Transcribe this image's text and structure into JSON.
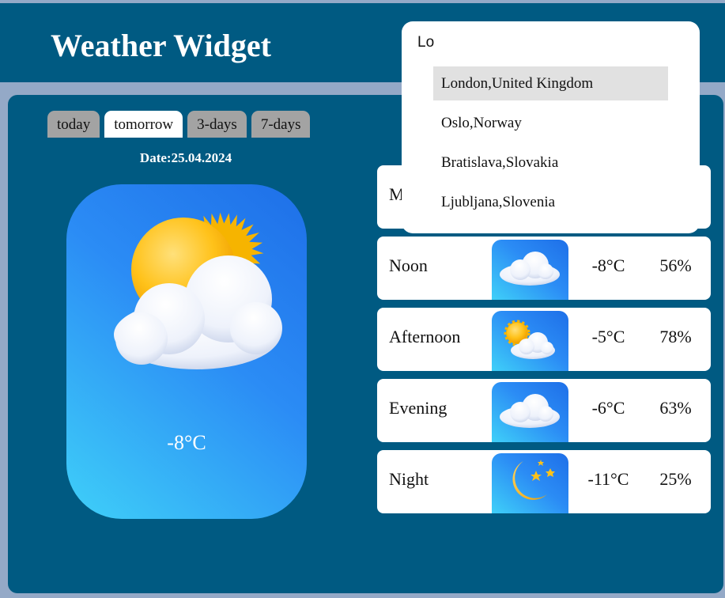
{
  "header": {
    "title": "Weather Widget"
  },
  "tabs": [
    {
      "label": "today",
      "active": false
    },
    {
      "label": "tomorrow",
      "active": true
    },
    {
      "label": "3-days",
      "active": false
    },
    {
      "label": "7-days",
      "active": false
    }
  ],
  "date": {
    "text": "Date:25.04.2024"
  },
  "main_card": {
    "temperature": "-8°C",
    "icon": "sun-behind-cloud-icon"
  },
  "rows": [
    {
      "label": "Morning",
      "icon": "cloud-icon",
      "temp": "",
      "humidity": ""
    },
    {
      "label": "Noon",
      "icon": "cloud-icon",
      "temp": "-8°C",
      "humidity": "56%"
    },
    {
      "label": "Afternoon",
      "icon": "sun-behind-cloud-icon",
      "temp": "-5°C",
      "humidity": "78%"
    },
    {
      "label": "Evening",
      "icon": "cloud-icon",
      "temp": "-6°C",
      "humidity": "63%"
    },
    {
      "label": "Night",
      "icon": "moon-stars-icon",
      "temp": "-11°C",
      "humidity": "25%"
    }
  ],
  "search": {
    "value": "Lo",
    "suggestions": [
      {
        "label": "London,United Kingdom",
        "highlighted": true
      },
      {
        "label": "Oslo,Norway",
        "highlighted": false
      },
      {
        "label": "Bratislava,Slovakia",
        "highlighted": false
      },
      {
        "label": "Ljubljana,Slovenia",
        "highlighted": false
      }
    ]
  },
  "colors": {
    "page_background": "#94a9c7",
    "panel": "#005a82",
    "card_gradient_top": "#1e6fe8",
    "card_gradient_bottom": "#3fd0f8",
    "tab_inactive": "#a3a3a3",
    "highlight": "#e1e1e1"
  }
}
